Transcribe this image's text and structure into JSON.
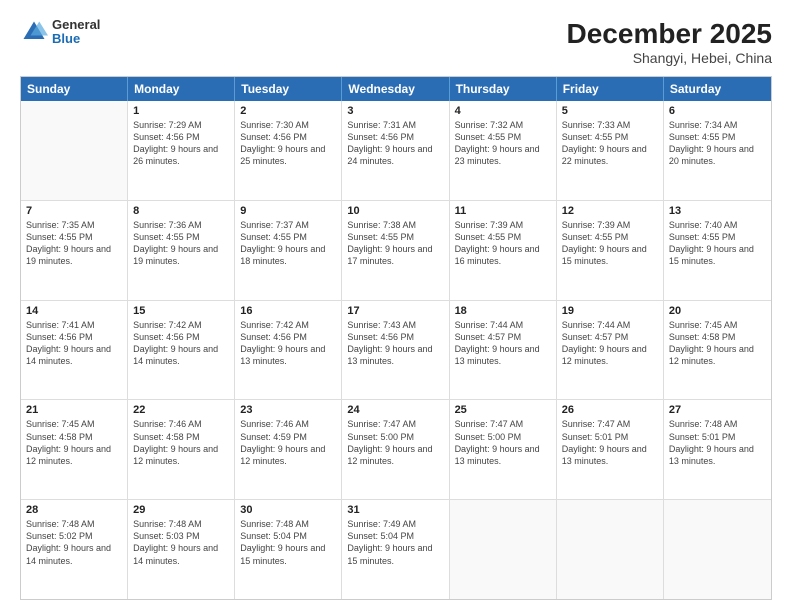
{
  "header": {
    "logo_general": "General",
    "logo_blue": "Blue",
    "month_title": "December 2025",
    "location": "Shangyi, Hebei, China"
  },
  "calendar": {
    "days_of_week": [
      "Sunday",
      "Monday",
      "Tuesday",
      "Wednesday",
      "Thursday",
      "Friday",
      "Saturday"
    ],
    "weeks": [
      [
        {
          "day": "",
          "sunrise": "",
          "sunset": "",
          "daylight": ""
        },
        {
          "day": "1",
          "sunrise": "Sunrise: 7:29 AM",
          "sunset": "Sunset: 4:56 PM",
          "daylight": "Daylight: 9 hours and 26 minutes."
        },
        {
          "day": "2",
          "sunrise": "Sunrise: 7:30 AM",
          "sunset": "Sunset: 4:56 PM",
          "daylight": "Daylight: 9 hours and 25 minutes."
        },
        {
          "day": "3",
          "sunrise": "Sunrise: 7:31 AM",
          "sunset": "Sunset: 4:56 PM",
          "daylight": "Daylight: 9 hours and 24 minutes."
        },
        {
          "day": "4",
          "sunrise": "Sunrise: 7:32 AM",
          "sunset": "Sunset: 4:55 PM",
          "daylight": "Daylight: 9 hours and 23 minutes."
        },
        {
          "day": "5",
          "sunrise": "Sunrise: 7:33 AM",
          "sunset": "Sunset: 4:55 PM",
          "daylight": "Daylight: 9 hours and 22 minutes."
        },
        {
          "day": "6",
          "sunrise": "Sunrise: 7:34 AM",
          "sunset": "Sunset: 4:55 PM",
          "daylight": "Daylight: 9 hours and 20 minutes."
        }
      ],
      [
        {
          "day": "7",
          "sunrise": "Sunrise: 7:35 AM",
          "sunset": "Sunset: 4:55 PM",
          "daylight": "Daylight: 9 hours and 19 minutes."
        },
        {
          "day": "8",
          "sunrise": "Sunrise: 7:36 AM",
          "sunset": "Sunset: 4:55 PM",
          "daylight": "Daylight: 9 hours and 19 minutes."
        },
        {
          "day": "9",
          "sunrise": "Sunrise: 7:37 AM",
          "sunset": "Sunset: 4:55 PM",
          "daylight": "Daylight: 9 hours and 18 minutes."
        },
        {
          "day": "10",
          "sunrise": "Sunrise: 7:38 AM",
          "sunset": "Sunset: 4:55 PM",
          "daylight": "Daylight: 9 hours and 17 minutes."
        },
        {
          "day": "11",
          "sunrise": "Sunrise: 7:39 AM",
          "sunset": "Sunset: 4:55 PM",
          "daylight": "Daylight: 9 hours and 16 minutes."
        },
        {
          "day": "12",
          "sunrise": "Sunrise: 7:39 AM",
          "sunset": "Sunset: 4:55 PM",
          "daylight": "Daylight: 9 hours and 15 minutes."
        },
        {
          "day": "13",
          "sunrise": "Sunrise: 7:40 AM",
          "sunset": "Sunset: 4:55 PM",
          "daylight": "Daylight: 9 hours and 15 minutes."
        }
      ],
      [
        {
          "day": "14",
          "sunrise": "Sunrise: 7:41 AM",
          "sunset": "Sunset: 4:56 PM",
          "daylight": "Daylight: 9 hours and 14 minutes."
        },
        {
          "day": "15",
          "sunrise": "Sunrise: 7:42 AM",
          "sunset": "Sunset: 4:56 PM",
          "daylight": "Daylight: 9 hours and 14 minutes."
        },
        {
          "day": "16",
          "sunrise": "Sunrise: 7:42 AM",
          "sunset": "Sunset: 4:56 PM",
          "daylight": "Daylight: 9 hours and 13 minutes."
        },
        {
          "day": "17",
          "sunrise": "Sunrise: 7:43 AM",
          "sunset": "Sunset: 4:56 PM",
          "daylight": "Daylight: 9 hours and 13 minutes."
        },
        {
          "day": "18",
          "sunrise": "Sunrise: 7:44 AM",
          "sunset": "Sunset: 4:57 PM",
          "daylight": "Daylight: 9 hours and 13 minutes."
        },
        {
          "day": "19",
          "sunrise": "Sunrise: 7:44 AM",
          "sunset": "Sunset: 4:57 PM",
          "daylight": "Daylight: 9 hours and 12 minutes."
        },
        {
          "day": "20",
          "sunrise": "Sunrise: 7:45 AM",
          "sunset": "Sunset: 4:58 PM",
          "daylight": "Daylight: 9 hours and 12 minutes."
        }
      ],
      [
        {
          "day": "21",
          "sunrise": "Sunrise: 7:45 AM",
          "sunset": "Sunset: 4:58 PM",
          "daylight": "Daylight: 9 hours and 12 minutes."
        },
        {
          "day": "22",
          "sunrise": "Sunrise: 7:46 AM",
          "sunset": "Sunset: 4:58 PM",
          "daylight": "Daylight: 9 hours and 12 minutes."
        },
        {
          "day": "23",
          "sunrise": "Sunrise: 7:46 AM",
          "sunset": "Sunset: 4:59 PM",
          "daylight": "Daylight: 9 hours and 12 minutes."
        },
        {
          "day": "24",
          "sunrise": "Sunrise: 7:47 AM",
          "sunset": "Sunset: 5:00 PM",
          "daylight": "Daylight: 9 hours and 12 minutes."
        },
        {
          "day": "25",
          "sunrise": "Sunrise: 7:47 AM",
          "sunset": "Sunset: 5:00 PM",
          "daylight": "Daylight: 9 hours and 13 minutes."
        },
        {
          "day": "26",
          "sunrise": "Sunrise: 7:47 AM",
          "sunset": "Sunset: 5:01 PM",
          "daylight": "Daylight: 9 hours and 13 minutes."
        },
        {
          "day": "27",
          "sunrise": "Sunrise: 7:48 AM",
          "sunset": "Sunset: 5:01 PM",
          "daylight": "Daylight: 9 hours and 13 minutes."
        }
      ],
      [
        {
          "day": "28",
          "sunrise": "Sunrise: 7:48 AM",
          "sunset": "Sunset: 5:02 PM",
          "daylight": "Daylight: 9 hours and 14 minutes."
        },
        {
          "day": "29",
          "sunrise": "Sunrise: 7:48 AM",
          "sunset": "Sunset: 5:03 PM",
          "daylight": "Daylight: 9 hours and 14 minutes."
        },
        {
          "day": "30",
          "sunrise": "Sunrise: 7:48 AM",
          "sunset": "Sunset: 5:04 PM",
          "daylight": "Daylight: 9 hours and 15 minutes."
        },
        {
          "day": "31",
          "sunrise": "Sunrise: 7:49 AM",
          "sunset": "Sunset: 5:04 PM",
          "daylight": "Daylight: 9 hours and 15 minutes."
        },
        {
          "day": "",
          "sunrise": "",
          "sunset": "",
          "daylight": ""
        },
        {
          "day": "",
          "sunrise": "",
          "sunset": "",
          "daylight": ""
        },
        {
          "day": "",
          "sunrise": "",
          "sunset": "",
          "daylight": ""
        }
      ]
    ]
  }
}
